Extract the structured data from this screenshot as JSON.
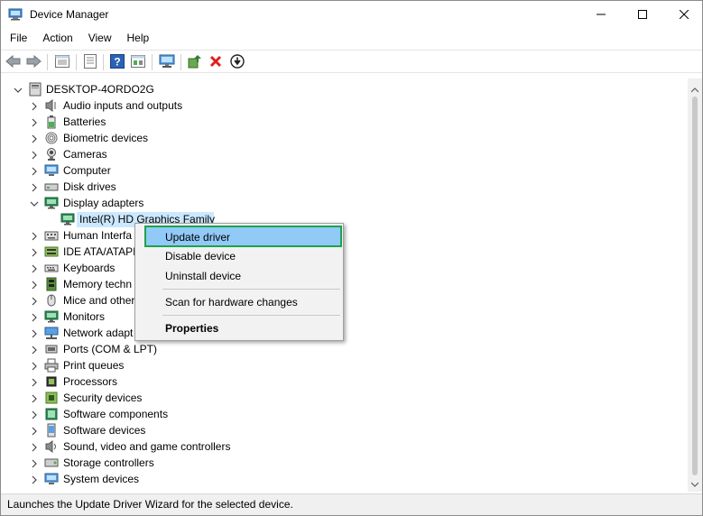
{
  "window": {
    "title": "Device Manager",
    "icon": "device-manager-icon",
    "controls": [
      "minimize",
      "maximize",
      "close"
    ]
  },
  "menu": [
    "File",
    "Action",
    "View",
    "Help"
  ],
  "toolbar": [
    "back-icon",
    "forward-icon",
    "properties-window-icon",
    "properties-sheet-icon",
    "help-icon",
    "show-hidden-icon",
    "monitor-icon",
    "update-driver-icon",
    "uninstall-icon",
    "download-icon"
  ],
  "tree": {
    "root": "DESKTOP-4ORDO2G",
    "items": [
      {
        "label": "Audio inputs and outputs",
        "icon": "speaker-icon",
        "expanded": false
      },
      {
        "label": "Batteries",
        "icon": "battery-icon",
        "expanded": false
      },
      {
        "label": "Biometric devices",
        "icon": "fingerprint-icon",
        "expanded": false
      },
      {
        "label": "Cameras",
        "icon": "camera-icon",
        "expanded": false
      },
      {
        "label": "Computer",
        "icon": "computer-icon",
        "expanded": false
      },
      {
        "label": "Disk drives",
        "icon": "disk-icon",
        "expanded": false
      },
      {
        "label": "Display adapters",
        "icon": "monitor-icon",
        "expanded": true
      },
      {
        "label": "Intel(R) HD Graphics Family",
        "icon": "display-adapter-icon",
        "child": true,
        "selected": true
      },
      {
        "label": "Human Interfa",
        "icon": "hid-icon",
        "expanded": false
      },
      {
        "label": "IDE ATA/ATAPI",
        "icon": "ide-icon",
        "expanded": false
      },
      {
        "label": "Keyboards",
        "icon": "keyboard-icon",
        "expanded": false
      },
      {
        "label": "Memory techn",
        "icon": "memory-icon",
        "expanded": false
      },
      {
        "label": "Mice and other",
        "icon": "mouse-icon",
        "expanded": false
      },
      {
        "label": "Monitors",
        "icon": "monitor-icon",
        "expanded": false
      },
      {
        "label": "Network adapt",
        "icon": "network-icon",
        "expanded": false
      },
      {
        "label": "Ports (COM & LPT)",
        "icon": "port-icon",
        "expanded": false
      },
      {
        "label": "Print queues",
        "icon": "printer-icon",
        "expanded": false
      },
      {
        "label": "Processors",
        "icon": "processor-icon",
        "expanded": false
      },
      {
        "label": "Security devices",
        "icon": "security-icon",
        "expanded": false
      },
      {
        "label": "Software components",
        "icon": "software-component-icon",
        "expanded": false
      },
      {
        "label": "Software devices",
        "icon": "software-device-icon",
        "expanded": false
      },
      {
        "label": "Sound, video and game controllers",
        "icon": "sound-icon",
        "expanded": false
      },
      {
        "label": "Storage controllers",
        "icon": "storage-icon",
        "expanded": false
      },
      {
        "label": "System devices",
        "icon": "system-icon",
        "expanded": false
      }
    ]
  },
  "context_menu": {
    "items": [
      {
        "label": "Update driver",
        "highlighted": true
      },
      {
        "label": "Disable device"
      },
      {
        "label": "Uninstall device"
      },
      {
        "label": "Scan for hardware changes"
      },
      {
        "label": "Properties",
        "bold": true
      }
    ],
    "highlight_border": "#1ea24c",
    "highlight_fill": "#91c9f7"
  },
  "status": "Launches the Update Driver Wizard for the selected device."
}
